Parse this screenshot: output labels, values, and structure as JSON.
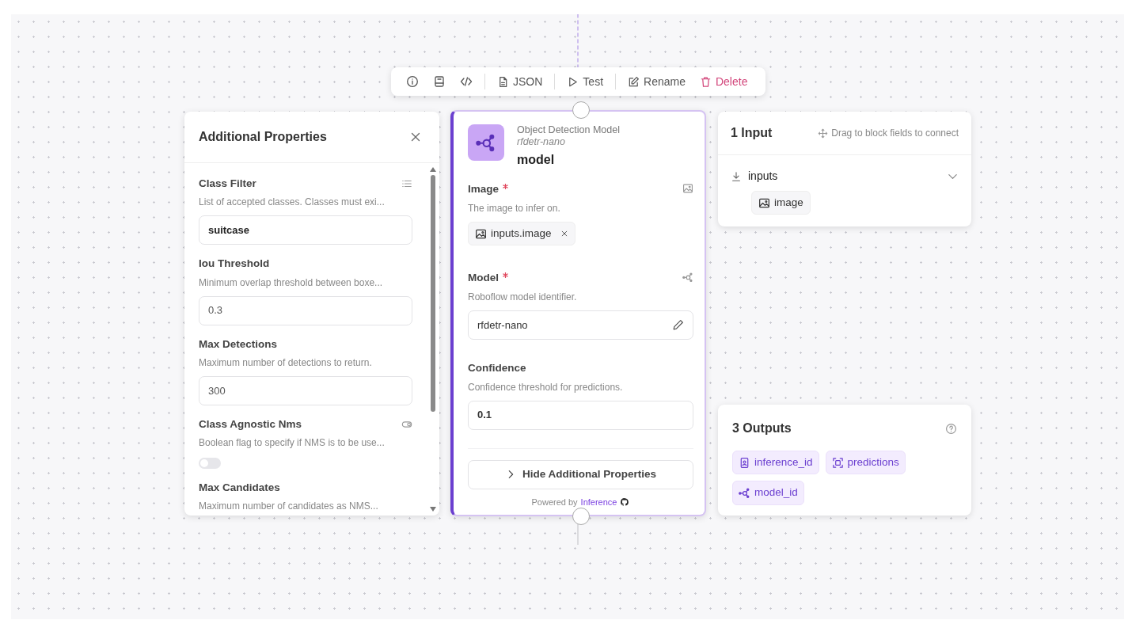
{
  "toolbar": {
    "icon_buttons": [
      {
        "kind": "info"
      },
      {
        "kind": "docs"
      },
      {
        "kind": "code"
      }
    ],
    "buttons": [
      {
        "label": "JSON",
        "kind": "json",
        "danger": false
      },
      {
        "label": "Test",
        "kind": "test",
        "danger": false
      },
      {
        "label": "Rename",
        "kind": "rename",
        "danger": false
      },
      {
        "label": "Delete",
        "kind": "delete",
        "danger": true
      }
    ]
  },
  "properties_panel": {
    "title": "Additional Properties",
    "fields": [
      {
        "label": "Class Filter",
        "kind": "list",
        "description": "List of accepted classes. Classes must exi...",
        "value": "suitcase"
      },
      {
        "label": "Iou Threshold",
        "kind": "number",
        "description": "Minimum overlap threshold between boxe...",
        "value": "0.3"
      },
      {
        "label": "Max Detections",
        "kind": "number",
        "description": "Maximum number of detections to return.",
        "value": "300"
      },
      {
        "label": "Class Agnostic Nms",
        "kind": "toggle",
        "description": "Boolean flag to specify if NMS is to be use...",
        "on": false
      },
      {
        "label": "Max Candidates",
        "kind": "number",
        "description": "Maximum number of candidates as NMS..."
      }
    ]
  },
  "block": {
    "type": "Object Detection Model",
    "subtitle": "rfdetr-nano",
    "name": "model",
    "selected": true,
    "fields": [
      {
        "label": "Image",
        "required": true,
        "kind": "reference",
        "description": "The image to infer on.",
        "value": "inputs.image"
      },
      {
        "label": "Model",
        "required": true,
        "kind": "model",
        "description": "Roboflow model identifier.",
        "value": "rfdetr-nano"
      },
      {
        "label": "Confidence",
        "required": false,
        "kind": "number",
        "description": "Confidence threshold for predictions.",
        "value": "0.1"
      }
    ],
    "toggle_button": "Hide Additional Properties",
    "footer": {
      "text": "Powered by",
      "link": "Inference"
    }
  },
  "inputs_panel": {
    "title": "1 Input",
    "hint": "Drag to block fields to connect",
    "groups": [
      {
        "name": "inputs",
        "expanded": true,
        "items": [
          {
            "label": "image",
            "kind": "image"
          }
        ]
      }
    ]
  },
  "outputs_panel": {
    "title": "3 Outputs",
    "outputs": [
      {
        "label": "inference_id",
        "kind": "id"
      },
      {
        "label": "predictions",
        "kind": "predictions"
      },
      {
        "label": "model_id",
        "kind": "model"
      }
    ]
  }
}
